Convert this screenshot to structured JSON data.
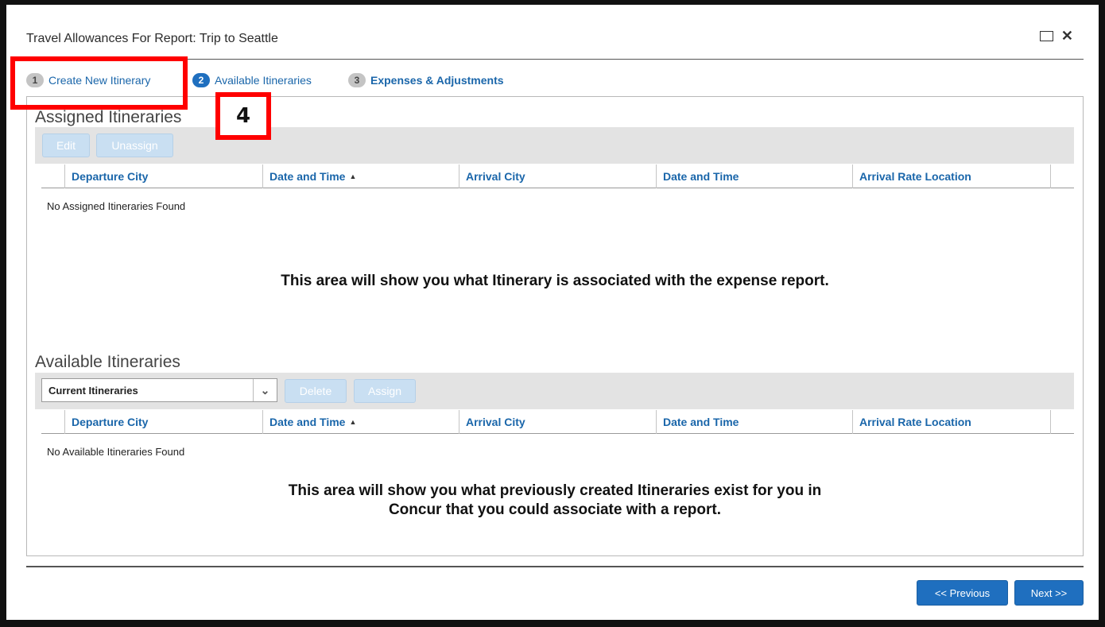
{
  "dialog": {
    "title": "Travel Allowances For Report: Trip to Seattle"
  },
  "steps": [
    {
      "number": "1",
      "label": "Create New Itinerary"
    },
    {
      "number": "2",
      "label": "Available Itineraries"
    },
    {
      "number": "3",
      "label": "Expenses & Adjustments"
    }
  ],
  "callout": {
    "label": "4"
  },
  "assigned": {
    "section_title": "Assigned Itineraries",
    "edit_label": "Edit",
    "unassign_label": "Unassign",
    "columns": [
      "Departure City",
      "Date and Time",
      "Arrival City",
      "Date and Time",
      "Arrival Rate Location"
    ],
    "empty_text": "No Assigned Itineraries Found",
    "note": "This area will show you what Itinerary is associated with the expense report."
  },
  "available": {
    "section_title": "Available Itineraries",
    "filter_selected": "Current Itineraries",
    "delete_label": "Delete",
    "assign_label": "Assign",
    "columns": [
      "Departure City",
      "Date and Time",
      "Arrival City",
      "Date and Time",
      "Arrival Rate Location"
    ],
    "empty_text": "No Available Itineraries Found",
    "note_line1": "This area will show you what previously created Itineraries exist for you in",
    "note_line2": "Concur that you could associate with a report."
  },
  "footer": {
    "previous_label": "<< Previous",
    "next_label": "Next >>"
  },
  "icons": {
    "maximize": "maximize-icon",
    "close": "close-icon",
    "sort": "sort-up-icon",
    "dropdown": "chevron-down-icon"
  },
  "colors": {
    "accent": "#1f6fbf",
    "link": "#1a66aa",
    "callout_border": "#ff0000"
  }
}
